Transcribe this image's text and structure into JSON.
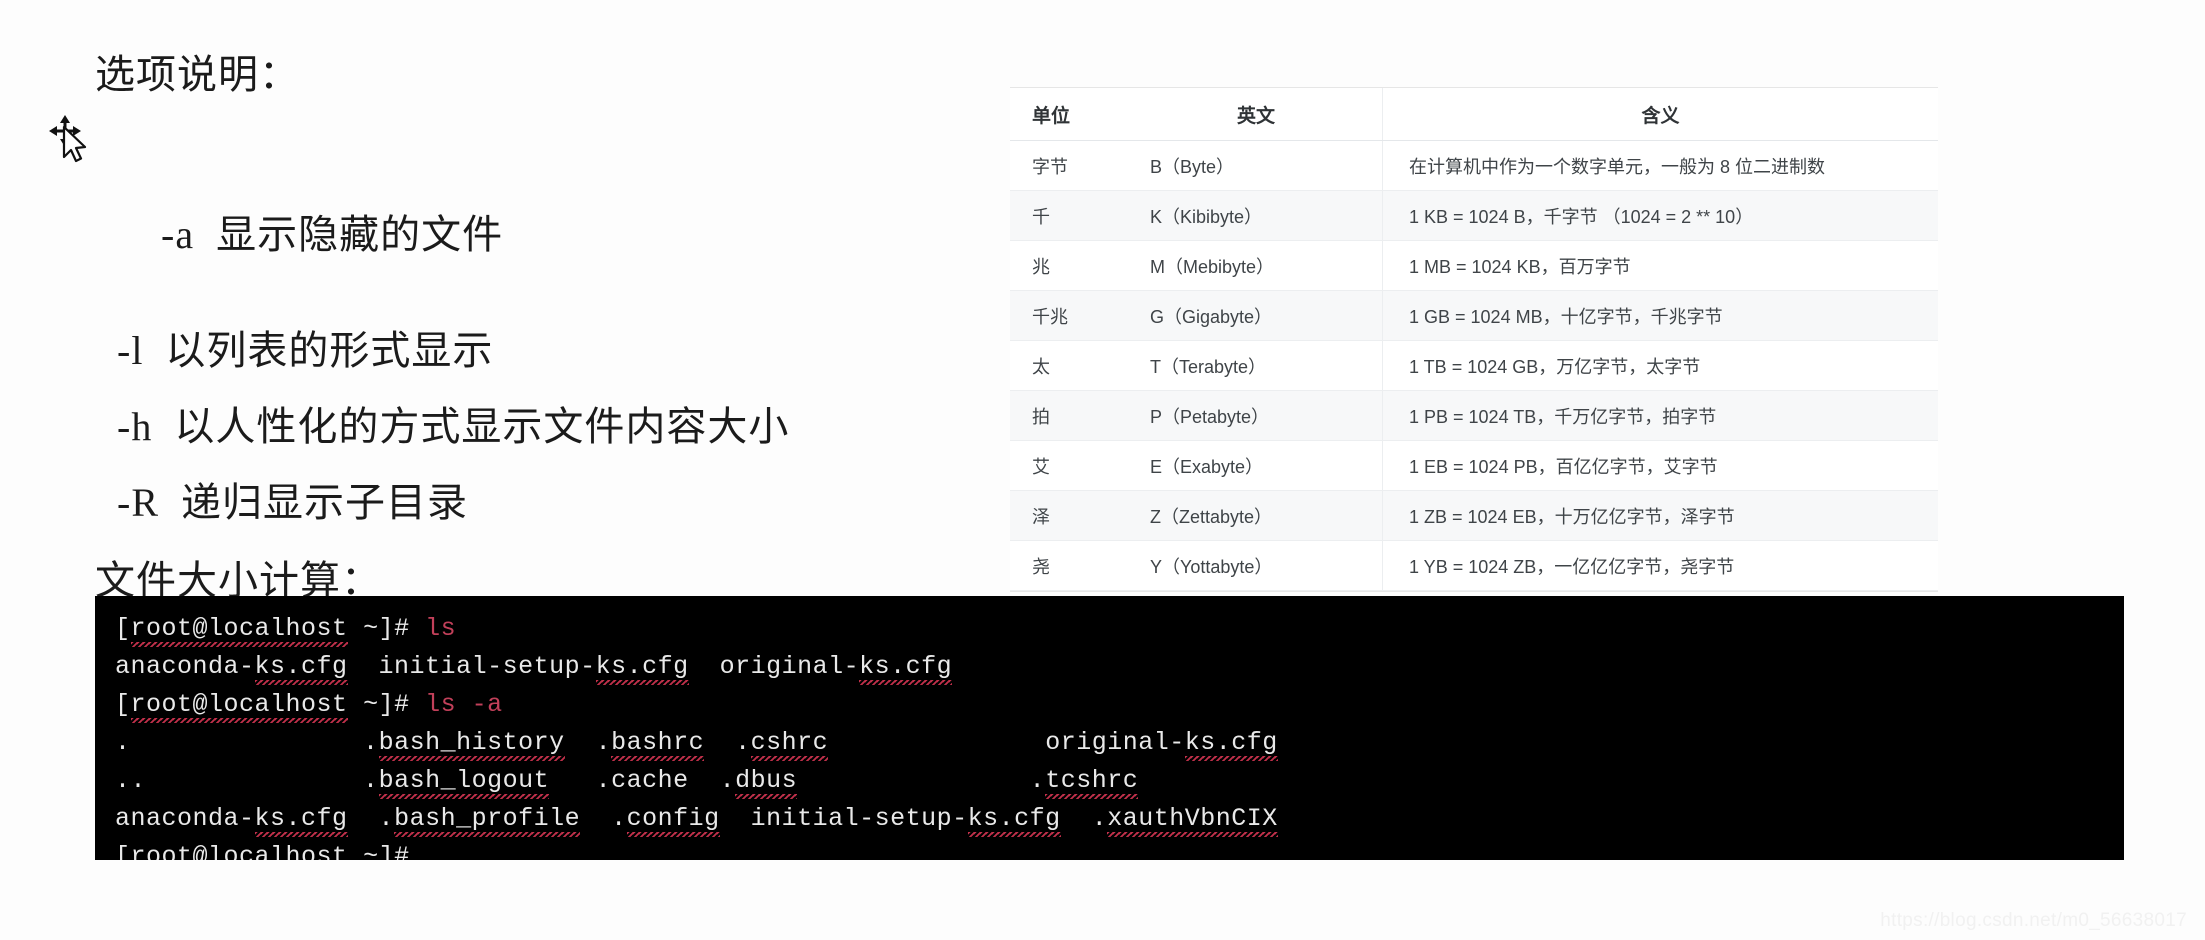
{
  "notes": {
    "heading": "选项说明：",
    "options": [
      {
        "flag": "-a",
        "desc": "显示隐藏的文件"
      },
      {
        "flag": "-l",
        "desc": "以列表的形式显示"
      },
      {
        "flag": "-h",
        "desc": "以人性化的方式显示文件内容大小"
      },
      {
        "flag": "-R",
        "desc": "递归显示子目录"
      }
    ],
    "option_a_line": "-a  显示隐藏的文件",
    "option_l_line": "-l  以列表的形式显示",
    "option_h_line": "-h  以人性化的方式显示文件内容大小",
    "option_r_line": "-R  递归显示子目录",
    "footer": "文件大小计算："
  },
  "cursor": {
    "icon": "move-cursor-icon"
  },
  "units_table": {
    "headers": [
      "单位",
      "英文",
      "含义"
    ],
    "rows": [
      {
        "unit": "字节",
        "english": "B（Byte）",
        "meaning": "在计算机中作为一个数字单元，一般为 8 位二进制数"
      },
      {
        "unit": "千",
        "english": "K（Kibibyte）",
        "meaning": "1 KB = 1024 B，千字节 （1024 = 2 ** 10）"
      },
      {
        "unit": "兆",
        "english": "M（Mebibyte）",
        "meaning": "1 MB = 1024 KB，百万字节"
      },
      {
        "unit": "千兆",
        "english": "G（Gigabyte）",
        "meaning": "1 GB = 1024 MB，十亿字节，千兆字节"
      },
      {
        "unit": "太",
        "english": "T（Terabyte）",
        "meaning": "1 TB = 1024 GB，万亿字节，太字节"
      },
      {
        "unit": "拍",
        "english": "P（Petabyte）",
        "meaning": "1 PB = 1024 TB，千万亿字节，拍字节"
      },
      {
        "unit": "艾",
        "english": "E（Exabyte）",
        "meaning": "1 EB = 1024 PB，百亿亿字节，艾字节"
      },
      {
        "unit": "泽",
        "english": "Z（Zettabyte）",
        "meaning": "1 ZB = 1024 EB，十万亿亿字节，泽字节"
      },
      {
        "unit": "尧",
        "english": "Y（Yottabyte）",
        "meaning": "1 YB = 1024 ZB，一亿亿亿字节，尧字节"
      }
    ]
  },
  "terminal": {
    "prompt": "[root@localhost ~]#",
    "host_token": "root@localhost",
    "commands": [
      "ls",
      "ls -a"
    ],
    "lines": [
      {
        "type": "prompt",
        "command": "ls"
      },
      {
        "type": "output",
        "cells": [
          "anaconda-ks.cfg",
          "initial-setup-ks.cfg",
          "original-ks.cfg"
        ]
      },
      {
        "type": "prompt",
        "command": "ls -a"
      },
      {
        "type": "output",
        "cells": [
          ".",
          ".bash_history",
          ".bashrc",
          ".cshrc",
          "original-ks.cfg"
        ]
      },
      {
        "type": "output",
        "cells": [
          "..",
          ".bash_logout",
          ".cache",
          ".dbus",
          ".tcshrc"
        ]
      },
      {
        "type": "output",
        "cells": [
          "anaconda-ks.cfg",
          ".bash_profile",
          ".config",
          "initial-setup-ks.cfg",
          ".xauthVbnCIX"
        ]
      },
      {
        "type": "prompt",
        "command": ""
      }
    ],
    "ls_row1": {
      "c1": "anaconda-ks.cfg",
      "c2": "initial-setup-ks.cfg",
      "c3": "original-ks.cfg"
    },
    "lsa_row1": {
      "c1": ".",
      "c2": ".bash_history",
      "c3": ".bashrc",
      "c4": ".cshrc",
      "c5": "original-ks.cfg"
    },
    "lsa_row2": {
      "c1": "..",
      "c2": ".bash_logout",
      "c3": ".cache",
      "c4": ".dbus",
      "c5": ".tcshrc"
    },
    "lsa_row3": {
      "c1": "anaconda-ks.cfg",
      "c2": ".bash_profile",
      "c3": ".config",
      "c4": "initial-setup-ks.cfg",
      "c5": ".xauthVbnCIX"
    }
  },
  "watermark": "https://blog.csdn.net/m0_56638017",
  "colors": {
    "terminal_bg": "#000000",
    "terminal_fg": "#e9e9e9",
    "command_red": "#c2405a",
    "squiggle_red": "#c0304a",
    "table_stripe": "#f7f8f9",
    "table_border": "#eceef0"
  }
}
